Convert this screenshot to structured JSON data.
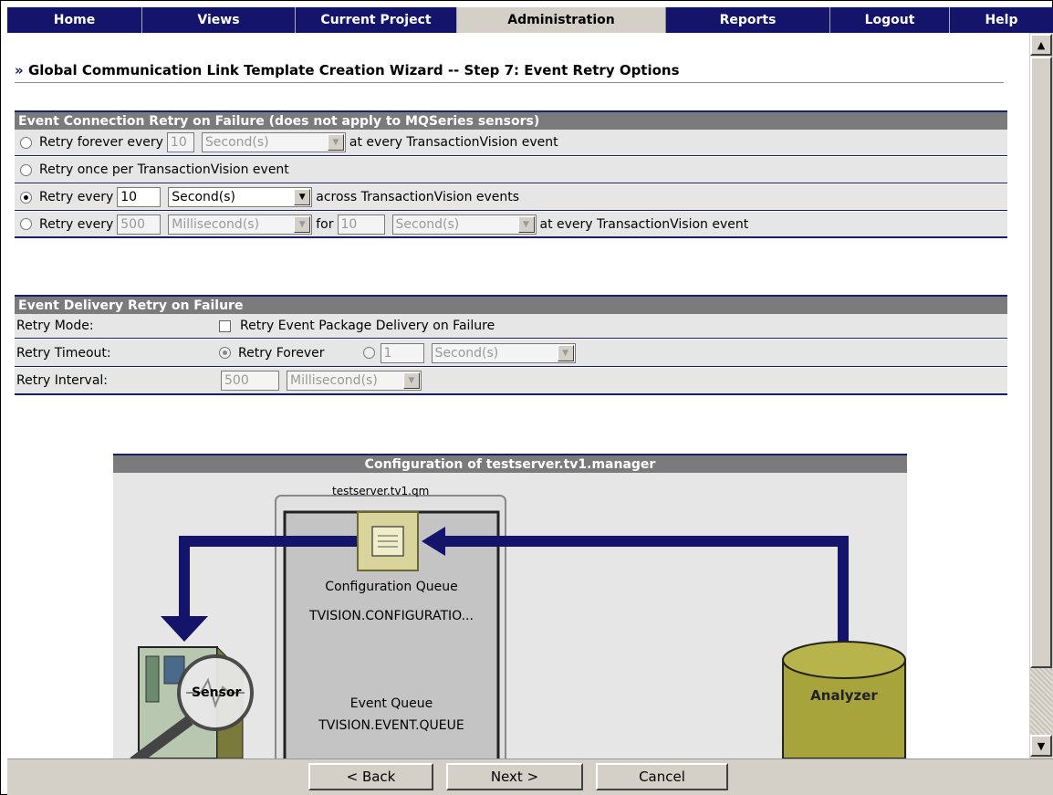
{
  "nav": {
    "items": [
      {
        "label": "Home"
      },
      {
        "label": "Views"
      },
      {
        "label": "Current Project"
      },
      {
        "label": "Administration"
      },
      {
        "label": "Reports"
      },
      {
        "label": "Logout"
      },
      {
        "label": "Help"
      }
    ],
    "active": "Administration"
  },
  "page": {
    "title_prefix": "»",
    "title": "Global Communication Link Template Creation Wizard -- Step 7: Event Retry Options"
  },
  "connection_retry": {
    "heading": "Event Connection Retry on Failure (does not apply to MQSeries sensors)",
    "opt1": {
      "label": "Retry forever every",
      "value": "10",
      "unit": "Second(s)",
      "suffix": "at every TransactionVision event",
      "selected": false
    },
    "opt2": {
      "label": "Retry once per TransactionVision event",
      "selected": false
    },
    "opt3": {
      "label": "Retry every",
      "value": "10",
      "unit": "Second(s)",
      "suffix": "across TransactionVision events",
      "selected": true
    },
    "opt4": {
      "label": "Retry every",
      "value": "500",
      "unit": "Millisecond(s)",
      "mid": "for",
      "value2": "10",
      "unit2": "Second(s)",
      "suffix": "at every TransactionVision event",
      "selected": false
    }
  },
  "delivery_retry": {
    "heading": "Event Delivery Retry on Failure",
    "mode_label": "Retry Mode:",
    "mode_checkbox": "Retry Event Package Delivery on Failure",
    "mode_checked": false,
    "timeout_label": "Retry Timeout:",
    "timeout_forever": "Retry Forever",
    "timeout_value": "1",
    "timeout_unit": "Second(s)",
    "interval_label": "Retry Interval:",
    "interval_value": "500",
    "interval_unit": "Millisecond(s)"
  },
  "diagram": {
    "heading": "Configuration of testserver.tv1.manager",
    "qm_name": "testserver.tv1.qm",
    "config_queue_label": "Configuration Queue",
    "config_queue_name": "TVISION.CONFIGURATIO...",
    "event_queue_label": "Event Queue",
    "event_queue_name": "TVISION.EVENT.QUEUE",
    "sensor_label": "Sensor",
    "analyzer_label": "Analyzer",
    "colors": {
      "arrow": "#14146b",
      "analyzer": "#a8a43c",
      "queue_box": "#d8d49c"
    }
  },
  "buttons": {
    "back": "< Back",
    "next": "Next >",
    "cancel": "Cancel"
  }
}
